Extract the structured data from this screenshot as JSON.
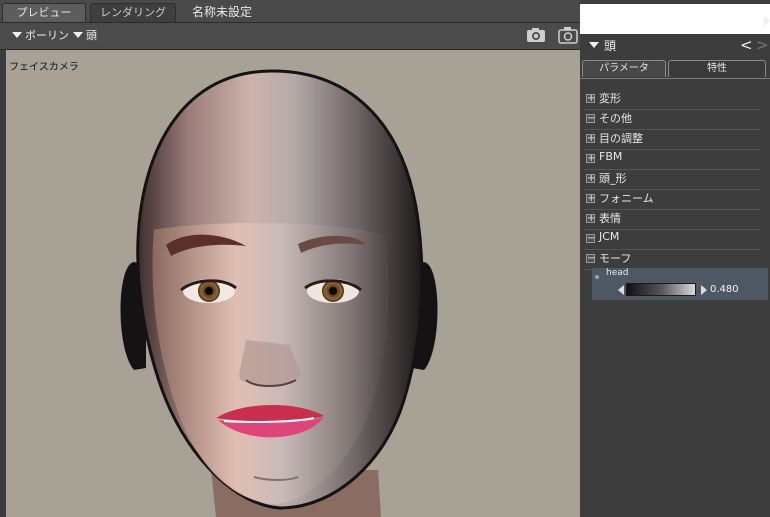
{
  "tabs": {
    "preview": "プレビュー",
    "render": "レンダリング"
  },
  "document": {
    "title": "名称未設定"
  },
  "toolbar": {
    "bone_dropdown": "ボーリン",
    "part_dropdown": "頭"
  },
  "viewport": {
    "camera_label": "フェイスカメラ"
  },
  "panel": {
    "title": "頭",
    "nav_prev": "<",
    "nav_next": ">",
    "tabs": {
      "parameters": "パラメータ",
      "properties": "特性"
    },
    "categories": [
      {
        "box": "+",
        "label": "変形"
      },
      {
        "box": "−",
        "label": "その他"
      },
      {
        "box": "+",
        "label": "目の調整"
      },
      {
        "box": "+",
        "label": "FBM"
      },
      {
        "box": "+",
        "label": "頭_形"
      },
      {
        "box": "+",
        "label": "フォニーム"
      },
      {
        "box": "+",
        "label": "表情"
      },
      {
        "box": "−",
        "label": "JCM"
      },
      {
        "box": "−",
        "label": "モーフ"
      }
    ],
    "slider": {
      "name": "head",
      "value": "0.480"
    }
  },
  "colors": {
    "viewport_bg": "#a8a296",
    "panel_bg": "#3d3d3d",
    "slider_bg": "#4e5865"
  }
}
